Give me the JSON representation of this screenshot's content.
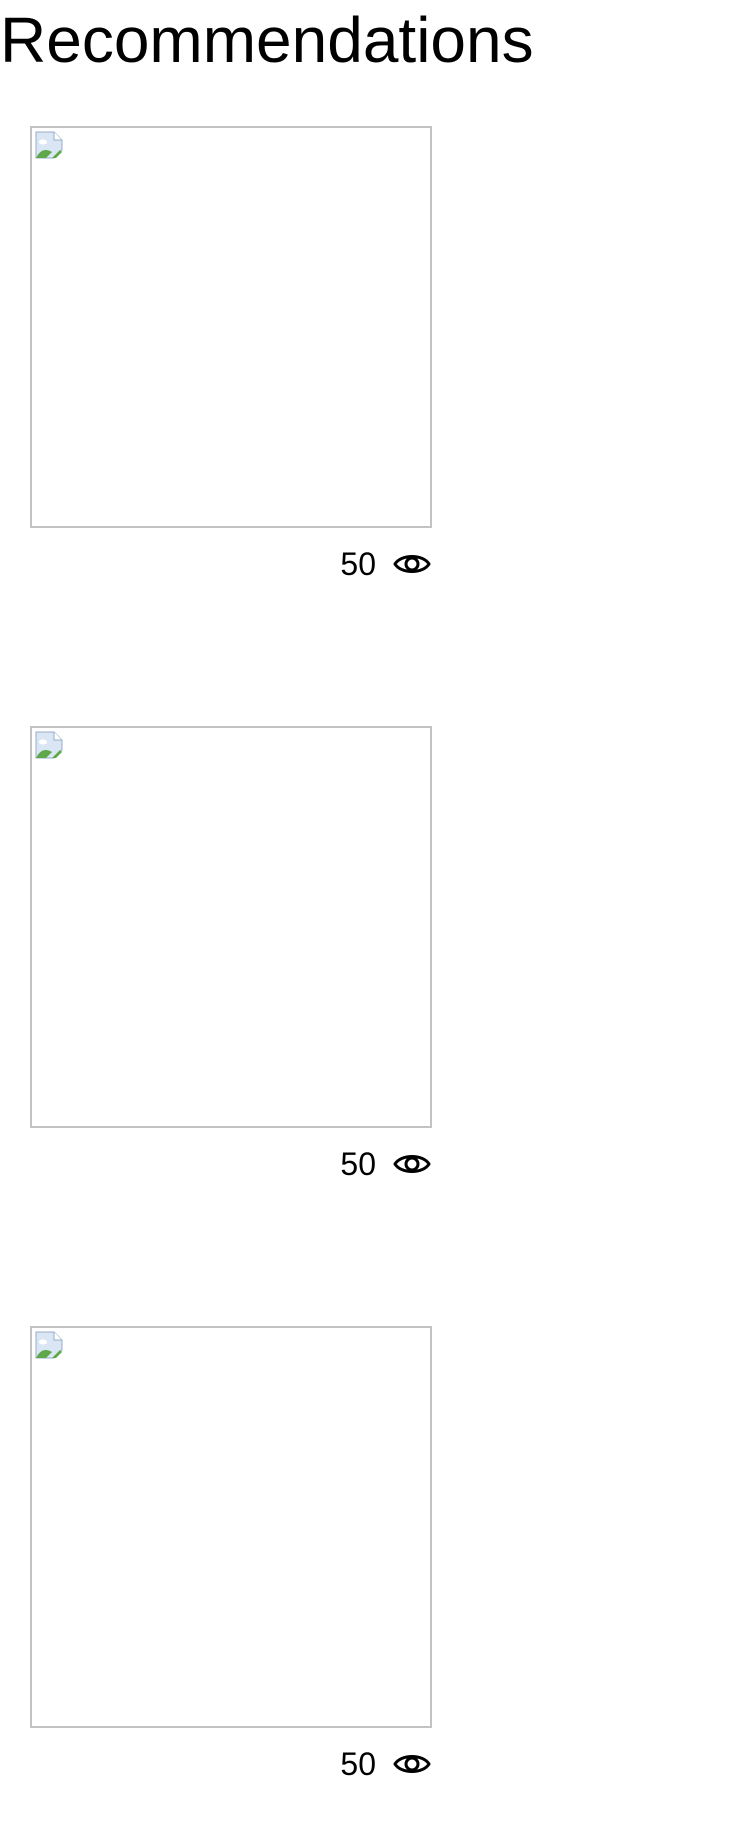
{
  "header": {
    "title": "Recommendations"
  },
  "recommendations": [
    {
      "views": "50",
      "thumbnail_icon": "broken-image-icon",
      "views_icon": "eye-icon"
    },
    {
      "views": "50",
      "thumbnail_icon": "broken-image-icon",
      "views_icon": "eye-icon"
    },
    {
      "views": "50",
      "thumbnail_icon": "broken-image-icon",
      "views_icon": "eye-icon"
    }
  ],
  "colors": {
    "thumbnail_border": "#c2c2c2",
    "text": "#000000",
    "background": "#ffffff"
  }
}
